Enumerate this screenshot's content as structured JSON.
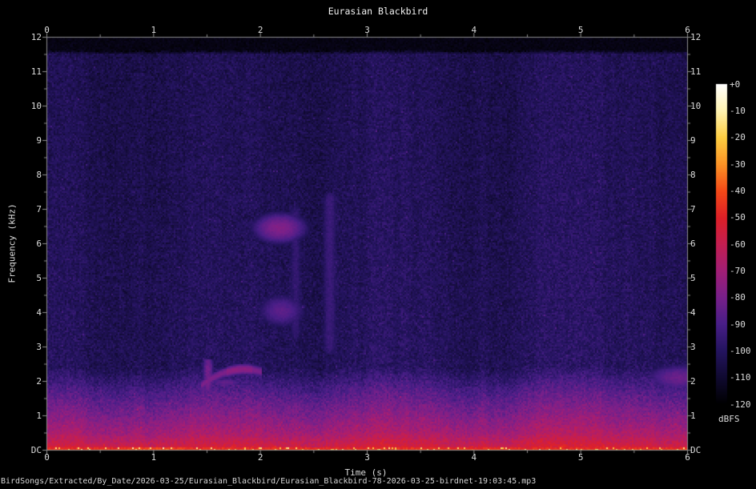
{
  "title": "Eurasian Blackbird",
  "footer": {
    "file_path": "BirdSongs/Extracted/By_Date/2026-03-25/Eurasian_Blackbird/Eurasian_Blackbird-78-2026-03-25-birdnet-19:03:45.mp3"
  },
  "axes": {
    "time": {
      "label": "Time (s)",
      "range_s": [
        0,
        6
      ],
      "major_tick_step_s": 1,
      "minor_tick_step_s": 0.5,
      "tick_labels": [
        "0",
        "1",
        "2",
        "3",
        "4",
        "5",
        "6"
      ]
    },
    "frequency": {
      "label": "Frequency (kHz)",
      "range_khz": [
        0,
        12
      ],
      "major_tick_step_khz": 1,
      "minor_tick_step_khz": 0.5,
      "tick_labels_top_to_bottom": [
        "12",
        "11",
        "10",
        "9",
        "8",
        "7",
        "6",
        "5",
        "4",
        "3",
        "2",
        "1",
        "DC"
      ]
    }
  },
  "colorbar": {
    "unit_label": "dBFS",
    "tick_labels_top_to_bottom": [
      "+0",
      "-10",
      "-20",
      "-30",
      "-40",
      "-50",
      "-60",
      "-70",
      "-80",
      "-90",
      "-100",
      "-110",
      "-120"
    ],
    "range_dbfs": [
      0,
      -120
    ],
    "palette_stops_dbfs_rgb": [
      [
        -120,
        [
          0,
          0,
          0
        ]
      ],
      [
        -110,
        [
          16,
          10,
          48
        ]
      ],
      [
        -100,
        [
          36,
          20,
          95
        ]
      ],
      [
        -90,
        [
          72,
          30,
          135
        ]
      ],
      [
        -80,
        [
          120,
          32,
          138
        ]
      ],
      [
        -70,
        [
          162,
          30,
          118
        ]
      ],
      [
        -60,
        [
          196,
          30,
          82
        ]
      ],
      [
        -50,
        [
          222,
          32,
          40
        ]
      ],
      [
        -40,
        [
          244,
          74,
          24
        ]
      ],
      [
        -30,
        [
          252,
          148,
          38
        ]
      ],
      [
        -20,
        [
          254,
          206,
          66
        ]
      ],
      [
        -10,
        [
          255,
          243,
          178
        ]
      ],
      [
        0,
        [
          255,
          255,
          255
        ]
      ]
    ]
  },
  "colors": {
    "background": "#000000",
    "axis": "#8c8c8c",
    "tick_label": "#dcdcdc",
    "title": "#f2f2f2"
  },
  "chart_data": {
    "type": "heatmap",
    "title": "Eurasian Blackbird",
    "xlabel": "Time (s)",
    "ylabel": "Frequency (kHz)",
    "zlabel": "dBFS",
    "x_range_s": [
      0,
      6
    ],
    "y_range_khz": [
      0,
      12
    ],
    "z_range_dbfs": [
      -120,
      0
    ],
    "description": "Audio spectrogram of a 6 s mp3 clip. Broadband low-frequency noise below ~2 kHz (magenta/red), a bright orange-yellow DC line, dark blue-purple noise floor in the mid/high band, a near-black band above the ~11.6 kHz mp3 cutoff, and faint bird-song traces near t=1.5-2 s (~2.3 kHz) and t=2-2.4 s (~6.5 kHz).",
    "noise_floor_profile_khz_dbfs": [
      [
        0.0,
        -50
      ],
      [
        0.15,
        -57
      ],
      [
        0.5,
        -68
      ],
      [
        1.0,
        -77
      ],
      [
        1.7,
        -88
      ],
      [
        2.4,
        -100.5
      ],
      [
        6.0,
        -101.5
      ],
      [
        11.5,
        -103
      ],
      [
        11.62,
        -117
      ],
      [
        12.0,
        -117
      ]
    ],
    "noise_jitter_db": 7,
    "column_variation_db": 2.5,
    "mp3_cutoff_khz": 11.6,
    "dc_line": {
      "freq_khz_max": 0.1,
      "dbfs_range": [
        -52,
        -22
      ],
      "hotspot_time_s": [
        0.7,
        1.3
      ]
    },
    "features": [
      {
        "kind": "blob",
        "t_s": 2.18,
        "f_khz": 6.45,
        "t_radius_s": 0.17,
        "f_radius_khz": 0.3,
        "peak_dbfs": -78,
        "note": "song element upper"
      },
      {
        "kind": "blob",
        "t_s": 2.2,
        "f_khz": 4.05,
        "t_radius_s": 0.16,
        "f_radius_khz": 0.35,
        "peak_dbfs": -86,
        "note": "song element mid, faint"
      },
      {
        "kind": "blob",
        "t_s": 1.68,
        "f_khz": 1.97,
        "t_radius_s": 0.12,
        "f_radius_khz": 0.09,
        "peak_dbfs": -84,
        "note": "low horizontal smear"
      },
      {
        "kind": "blob",
        "t_s": 5.92,
        "f_khz": 2.1,
        "t_radius_s": 0.22,
        "f_radius_khz": 0.28,
        "peak_dbfs": -83,
        "note": "right-edge patch ~2 kHz"
      },
      {
        "kind": "vstreak",
        "t_s": 2.65,
        "t_width_s": 0.05,
        "f_from_khz": 3.0,
        "f_to_khz": 7.3,
        "peak_dbfs": -94,
        "note": "faint vertical streak"
      },
      {
        "kind": "vstreak",
        "t_s": 2.33,
        "t_width_s": 0.045,
        "f_from_khz": 3.4,
        "f_to_khz": 6.9,
        "peak_dbfs": -96,
        "note": "faint vertical streak"
      },
      {
        "kind": "vstreak",
        "t_s": 1.51,
        "t_width_s": 0.03,
        "f_from_khz": 1.9,
        "f_to_khz": 2.45,
        "peak_dbfs": -81,
        "note": "short rising stroke of chirp"
      },
      {
        "kind": "arc",
        "t_from_s": 1.45,
        "t_to_s": 2.02,
        "t_peak_s": 1.85,
        "f_peak_khz": 2.35,
        "curvature": 2.9,
        "thickness_khz": 0.07,
        "peak_dbfs": -79,
        "bright_t_s": [
          1.68,
          1.92
        ],
        "note": "curved chirp ~2.3 kHz"
      }
    ]
  }
}
